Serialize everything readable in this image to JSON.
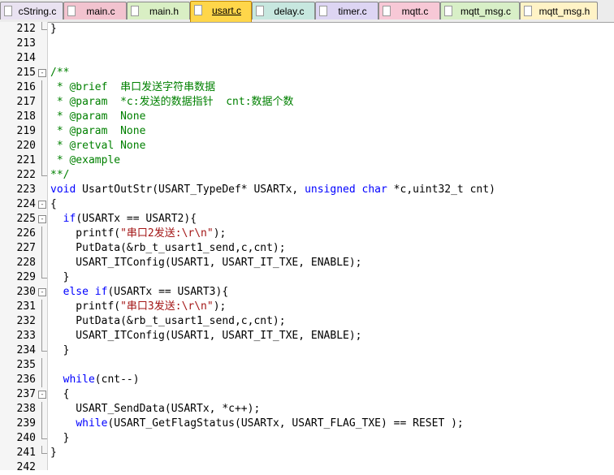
{
  "tabs": [
    {
      "label": "cString.c",
      "color": "#e9e2f1",
      "active": false
    },
    {
      "label": "main.c",
      "color": "#f2c3cf",
      "active": false
    },
    {
      "label": "main.h",
      "color": "#d9efc4",
      "active": false
    },
    {
      "label": "usart.c",
      "color": "#ffd64a",
      "active": true
    },
    {
      "label": "delay.c",
      "color": "#c7e7df",
      "active": false
    },
    {
      "label": "timer.c",
      "color": "#ddd5f3",
      "active": false
    },
    {
      "label": "mqtt.c",
      "color": "#f7c8d6",
      "active": false
    },
    {
      "label": "mqtt_msg.c",
      "color": "#d8efc7",
      "active": false
    },
    {
      "label": "mqtt_msg.h",
      "color": "#fff3c6",
      "active": false
    }
  ],
  "lines": [
    {
      "n": "212",
      "fold": "guide-end",
      "parts": [
        {
          "t": "}",
          "c": ""
        }
      ]
    },
    {
      "n": "213",
      "fold": "",
      "parts": []
    },
    {
      "n": "214",
      "fold": "",
      "parts": []
    },
    {
      "n": "215",
      "fold": "minus",
      "parts": [
        {
          "t": "/**",
          "c": "cm"
        }
      ]
    },
    {
      "n": "216",
      "fold": "guide",
      "parts": [
        {
          "t": " * @brief  串口发送字符串数据",
          "c": "cm"
        }
      ]
    },
    {
      "n": "217",
      "fold": "guide",
      "parts": [
        {
          "t": " * @param  *c:发送的数据指针  cnt:数据个数",
          "c": "cm"
        }
      ]
    },
    {
      "n": "218",
      "fold": "guide",
      "parts": [
        {
          "t": " * @param  None",
          "c": "cm"
        }
      ]
    },
    {
      "n": "219",
      "fold": "guide",
      "parts": [
        {
          "t": " * @param  None",
          "c": "cm"
        }
      ]
    },
    {
      "n": "220",
      "fold": "guide",
      "parts": [
        {
          "t": " * @retval None",
          "c": "cm"
        }
      ]
    },
    {
      "n": "221",
      "fold": "guide",
      "parts": [
        {
          "t": " * @example",
          "c": "cm"
        }
      ]
    },
    {
      "n": "222",
      "fold": "guide-end",
      "parts": [
        {
          "t": "**/",
          "c": "cm"
        }
      ]
    },
    {
      "n": "223",
      "fold": "",
      "parts": [
        {
          "t": "void",
          "c": "kw"
        },
        {
          "t": " UsartOutStr(USART_TypeDef* USARTx, ",
          "c": ""
        },
        {
          "t": "unsigned",
          "c": "kw"
        },
        {
          "t": " ",
          "c": ""
        },
        {
          "t": "char",
          "c": "kw"
        },
        {
          "t": " *c,uint32_t cnt)",
          "c": ""
        }
      ]
    },
    {
      "n": "224",
      "fold": "minus",
      "parts": [
        {
          "t": "{",
          "c": ""
        }
      ]
    },
    {
      "n": "225",
      "fold": "minus",
      "parts": [
        {
          "t": "  ",
          "c": ""
        },
        {
          "t": "if",
          "c": "kw"
        },
        {
          "t": "(USARTx == USART2){",
          "c": ""
        }
      ]
    },
    {
      "n": "226",
      "fold": "guide",
      "parts": [
        {
          "t": "    printf(",
          "c": ""
        },
        {
          "t": "\"串口2发送:\\r\\n\"",
          "c": "st"
        },
        {
          "t": ");",
          "c": ""
        }
      ]
    },
    {
      "n": "227",
      "fold": "guide",
      "parts": [
        {
          "t": "    PutData(&rb_t_usart1_send,c,cnt);",
          "c": ""
        }
      ]
    },
    {
      "n": "228",
      "fold": "guide",
      "parts": [
        {
          "t": "    USART_ITConfig(USART1, USART_IT_TXE, ENABLE);",
          "c": ""
        }
      ]
    },
    {
      "n": "229",
      "fold": "guide-end",
      "parts": [
        {
          "t": "  }",
          "c": ""
        }
      ]
    },
    {
      "n": "230",
      "fold": "minus",
      "parts": [
        {
          "t": "  ",
          "c": ""
        },
        {
          "t": "else",
          "c": "kw"
        },
        {
          "t": " ",
          "c": ""
        },
        {
          "t": "if",
          "c": "kw"
        },
        {
          "t": "(USARTx == USART3){",
          "c": ""
        }
      ]
    },
    {
      "n": "231",
      "fold": "guide",
      "parts": [
        {
          "t": "    printf(",
          "c": ""
        },
        {
          "t": "\"串口3发送:\\r\\n\"",
          "c": "st"
        },
        {
          "t": ");",
          "c": ""
        }
      ]
    },
    {
      "n": "232",
      "fold": "guide",
      "parts": [
        {
          "t": "    PutData(&rb_t_usart1_send,c,cnt);",
          "c": ""
        }
      ]
    },
    {
      "n": "233",
      "fold": "guide",
      "parts": [
        {
          "t": "    USART_ITConfig(USART1, USART_IT_TXE, ENABLE);",
          "c": ""
        }
      ]
    },
    {
      "n": "234",
      "fold": "guide-end",
      "parts": [
        {
          "t": "  }",
          "c": ""
        }
      ]
    },
    {
      "n": "235",
      "fold": "guide",
      "parts": []
    },
    {
      "n": "236",
      "fold": "guide",
      "parts": [
        {
          "t": "  ",
          "c": ""
        },
        {
          "t": "while",
          "c": "kw"
        },
        {
          "t": "(cnt--)",
          "c": ""
        }
      ]
    },
    {
      "n": "237",
      "fold": "minus",
      "parts": [
        {
          "t": "  {",
          "c": ""
        }
      ]
    },
    {
      "n": "238",
      "fold": "guide",
      "parts": [
        {
          "t": "    USART_SendData(USARTx, *c++);",
          "c": ""
        }
      ]
    },
    {
      "n": "239",
      "fold": "guide",
      "parts": [
        {
          "t": "    ",
          "c": ""
        },
        {
          "t": "while",
          "c": "kw"
        },
        {
          "t": "(USART_GetFlagStatus(USARTx, USART_FLAG_TXE) == RESET );",
          "c": ""
        }
      ]
    },
    {
      "n": "240",
      "fold": "guide-end",
      "parts": [
        {
          "t": "  }",
          "c": ""
        }
      ]
    },
    {
      "n": "241",
      "fold": "guide-end",
      "parts": [
        {
          "t": "}",
          "c": ""
        }
      ]
    },
    {
      "n": "242",
      "fold": "",
      "parts": []
    }
  ]
}
